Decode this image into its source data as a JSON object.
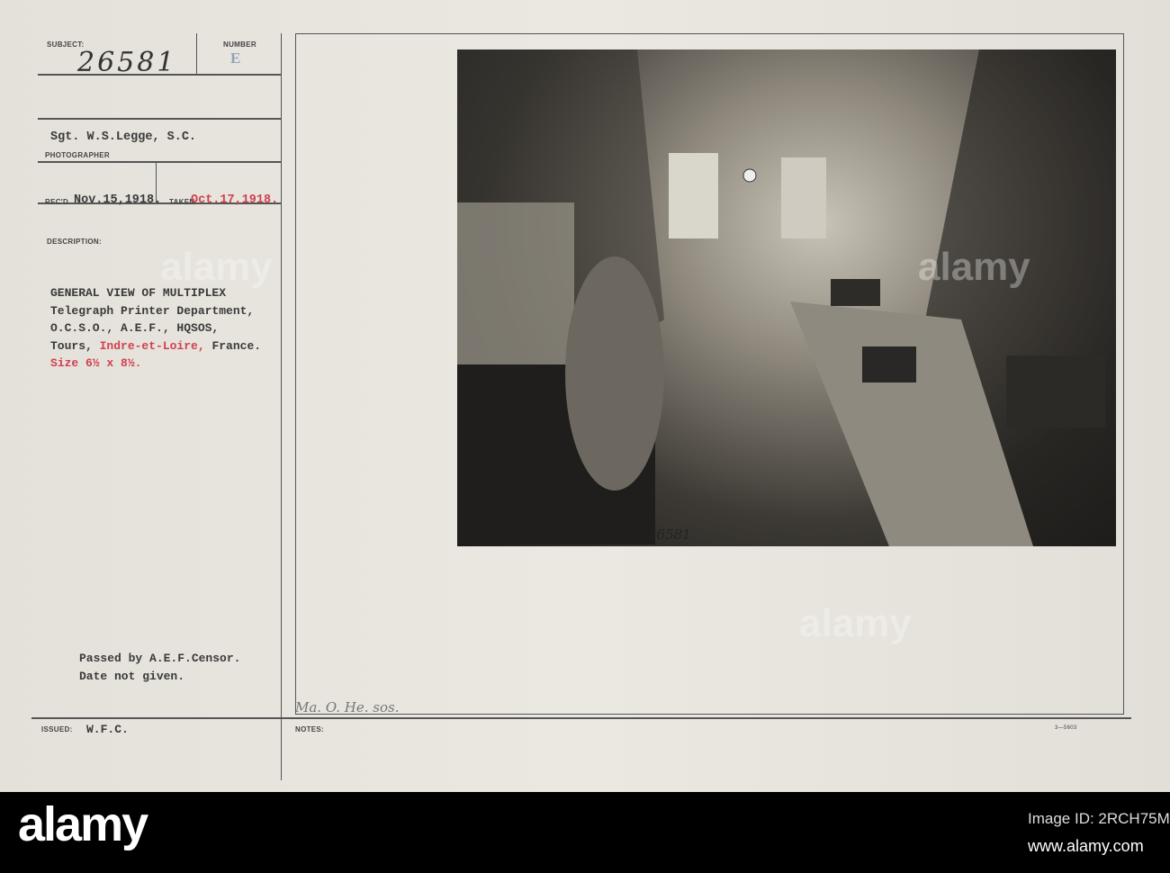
{
  "card": {
    "subject_label": "SUBJECT:",
    "subject_number": "26581",
    "number_label": "NUMBER",
    "number_stamp": "E",
    "photographer": "Sgt. W.S.Legge, S.C.",
    "photographer_label": "PHOTOGRAPHER",
    "recd_label": "REC'D",
    "recd_date": "Nov.15,1918.",
    "taken_label": "TAKEN",
    "taken_date": "Oct.17,1918.",
    "description_label": "DESCRIPTION:",
    "description_lines": [
      "GENERAL VIEW OF MULTIPLEX",
      "Telegraph Printer Department,",
      "O.C.S.O., A.E.F., HQSOS,"
    ],
    "description_line4_a": "Tours, ",
    "description_line4_red": "Indre-et-Loire,",
    "description_line4_b": " France.",
    "size": "Size 6½ x 8½.",
    "censor_lines": [
      "Passed by A.E.F.Censor.",
      "Date not given."
    ],
    "issued_label": "ISSUED:",
    "issued_value": "W.F.C.",
    "notes_label": "NOTES:",
    "notes_handwriting": "Ma. O. He. sos.",
    "form_number": "3—5603",
    "photo_caption": "26581"
  },
  "watermark": {
    "brand": "alamy",
    "image_id": "Image ID: 2RCH75M",
    "url": "www.alamy.com"
  }
}
